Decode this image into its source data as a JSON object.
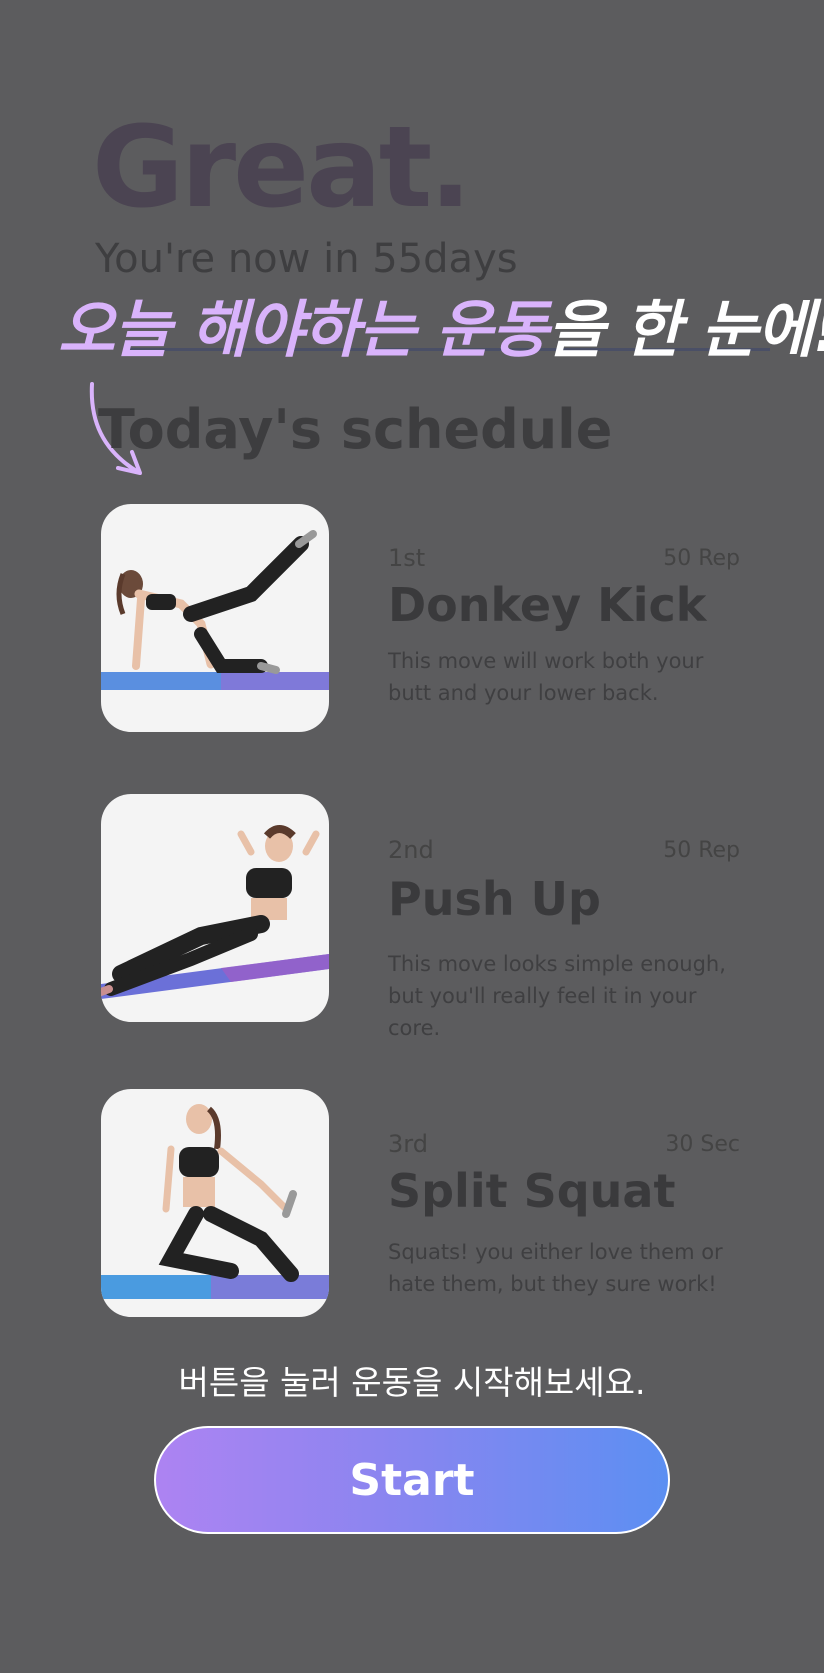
{
  "header": {
    "headline": "Great.",
    "subtitle": "You're now in 55days"
  },
  "annotation": {
    "highlight_text": "오늘 해야하는 운동",
    "rest_text": "을 한 눈에!"
  },
  "schedule": {
    "title": "Today's schedule",
    "items": [
      {
        "order": "1st",
        "amount": "50 Rep",
        "name": "Donkey Kick",
        "description_line1": "This move will work both your",
        "description_line2": "butt and your lower back."
      },
      {
        "order": "2nd",
        "amount": "50 Rep",
        "name": "Push Up",
        "description_line1": "This move looks simple enough,",
        "description_line2": "but you'll really feel it in your core."
      },
      {
        "order": "3rd",
        "amount": "30 Sec",
        "name": "Split Squat",
        "description_line1": "Squats! you either love them or",
        "description_line2": "hate them, but they sure work!"
      }
    ]
  },
  "cta": {
    "hint": "버튼을 눌러 운동을 시작해보세요.",
    "start_label": "Start"
  },
  "colors": {
    "background": "#5c5c5e",
    "annotation_purple": "#d9b3fb",
    "button_gradient_start": "#ad83f2",
    "button_gradient_end": "#5c8ff2"
  }
}
